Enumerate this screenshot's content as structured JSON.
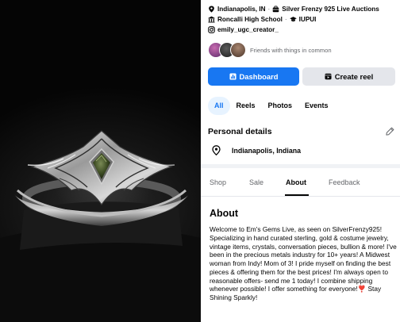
{
  "photo": {
    "subject": "ring-photo"
  },
  "profile": {
    "info_line_1": {
      "city": "Indianapolis, IN",
      "separator": "·",
      "workplace": "Silver Frenzy 925 Live Auctions"
    },
    "info_line_2": {
      "school": "Roncalli High School",
      "separator": "·",
      "college": "IUPUI"
    },
    "info_line_3": {
      "instagram": "emily_ugc_creator_"
    },
    "friends_text": "Friends with things in common"
  },
  "actions": {
    "dashboard_label": "Dashboard",
    "create_reel_label": "Create reel"
  },
  "filter_chips": [
    {
      "label": "All",
      "active": true
    },
    {
      "label": "Reels",
      "active": false
    },
    {
      "label": "Photos",
      "active": false
    },
    {
      "label": "Events",
      "active": false
    }
  ],
  "personal_details": {
    "title": "Personal details",
    "location": "Indianapolis, Indiana"
  },
  "page_tabs": [
    {
      "label": "Shop",
      "active": false
    },
    {
      "label": "Sale",
      "active": false
    },
    {
      "label": "About",
      "active": true
    },
    {
      "label": "Feedback",
      "active": false
    }
  ],
  "about": {
    "title": "About",
    "body_before_heart": "Welcome to Em's Gems Live, as seen on SilverFrenzy925! Specializing in hand curated sterling, gold & costume jewelry, vintage items, crystals, conversation pieces, bullion & more! I've been in the precious metals industry for 10+ years! A Midwest woman from Indy! Mom of 3! I pride myself on finding the best pieces & offering them for the best prices! I'm always open to reasonable offers- send me 1 today! I combine shipping whenever possible! I offer something for everyone!",
    "heart": "❣️",
    "body_after_heart": " Stay Shining Sparkly!"
  },
  "colors": {
    "accent": "#1877f2",
    "secondary_button": "#e4e6eb",
    "muted_text": "#65676b",
    "chip_active_bg": "#e7f3ff"
  }
}
